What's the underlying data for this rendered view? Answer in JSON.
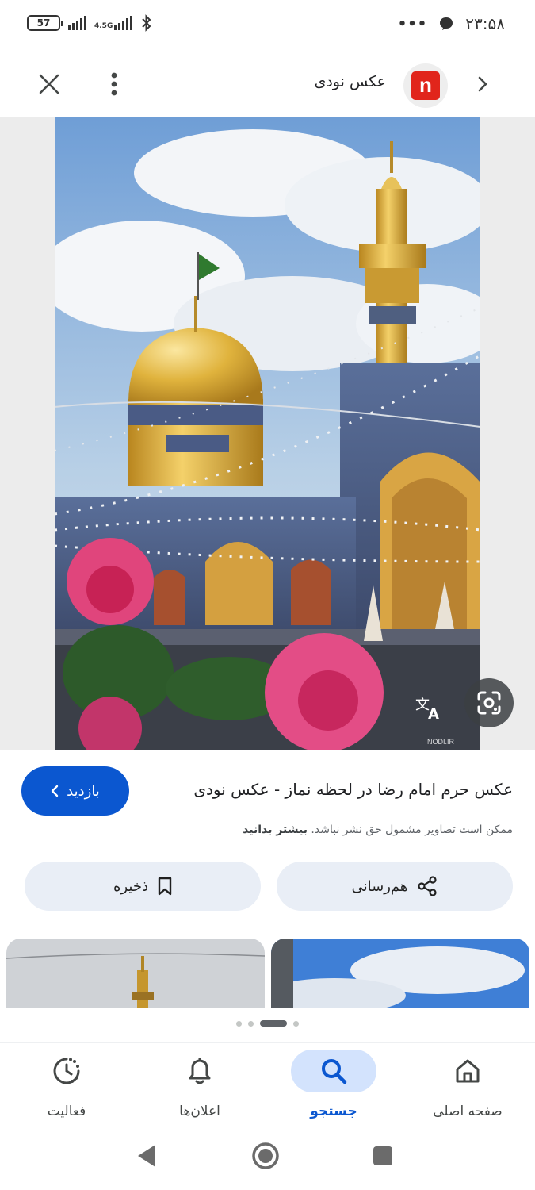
{
  "status_bar": {
    "battery": "57",
    "network": "4.5G",
    "time": "۲۳:۵۸"
  },
  "top_bar": {
    "site_name": "عکس نودی",
    "site_logo_letter": "n",
    "brand_color": "#e1251b"
  },
  "image": {
    "watermark": "NODI.IR"
  },
  "info": {
    "title": "عکس حرم امام رضا در لحظه نماز - عکس نودی",
    "visit_label": "بازدید",
    "notice_text": "ممکن است تصاویر مشمول حق نشر نباشد.",
    "notice_link": "بیشتر بدانید",
    "share_label": "هم‌رسانی",
    "save_label": "ذخیره"
  },
  "pager": {
    "count": 4,
    "active_index": 1
  },
  "bottom_nav": {
    "items": [
      {
        "label": "فعالیت",
        "icon": "activity-icon",
        "active": false
      },
      {
        "label": "اعلان‌ها",
        "icon": "bell-icon",
        "active": false
      },
      {
        "label": "جستجو",
        "icon": "search-icon",
        "active": true
      },
      {
        "label": "صفحه اصلی",
        "icon": "home-icon",
        "active": false
      }
    ]
  },
  "colors": {
    "accent": "#0b57d0",
    "active_nav_bg": "#d3e3fd",
    "button_bg": "#e9eef6"
  }
}
